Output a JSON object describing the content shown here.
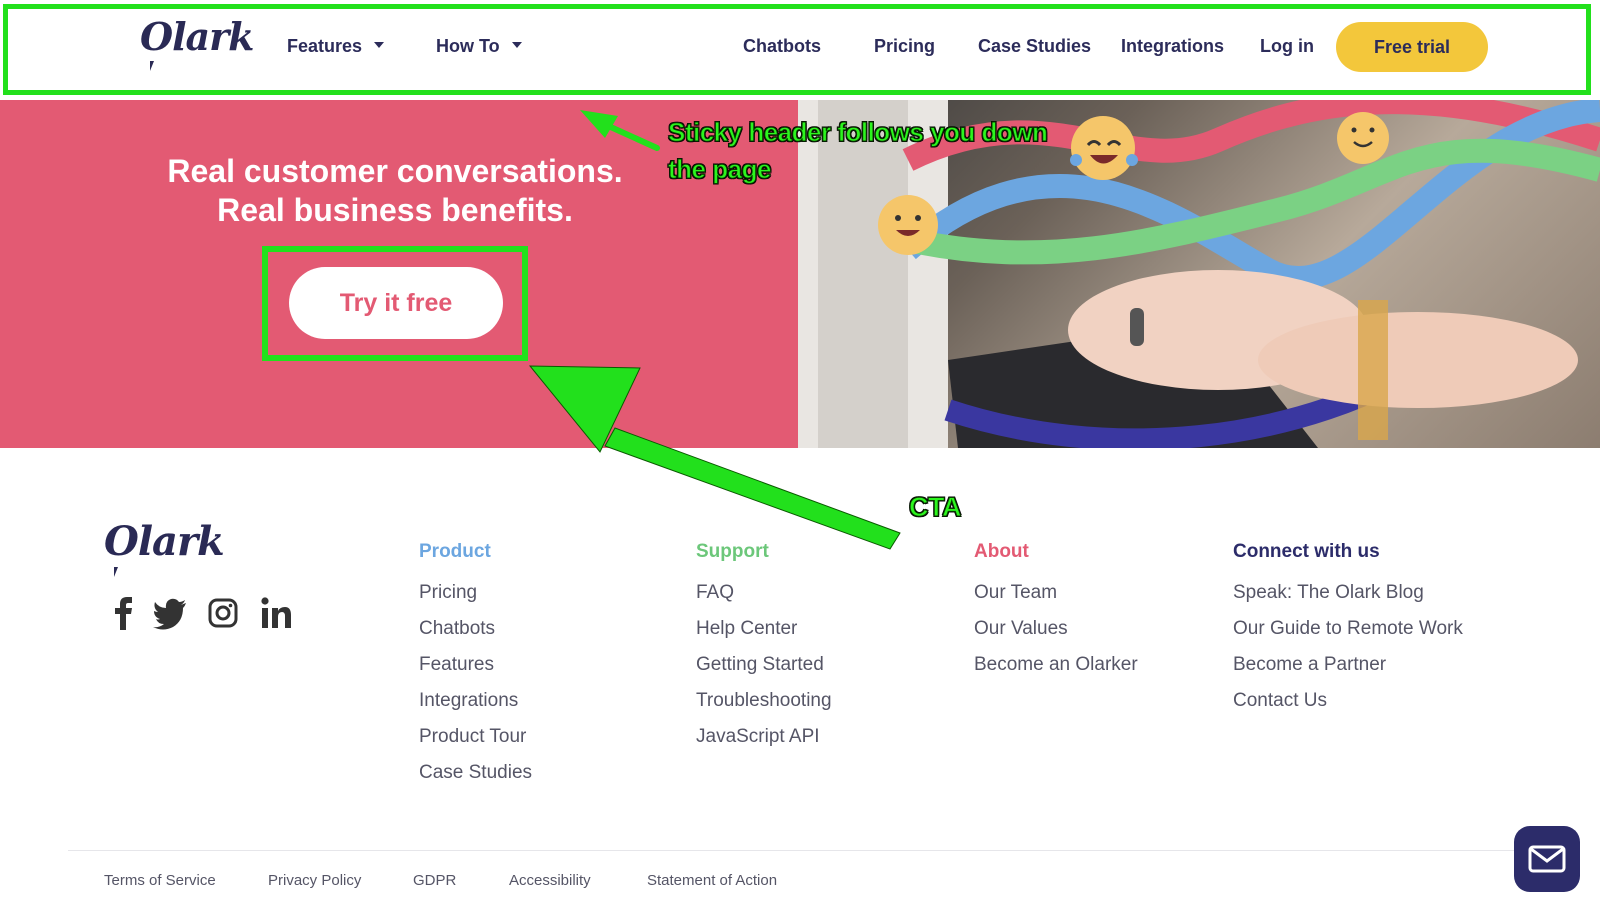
{
  "header": {
    "logo_text": "Olark",
    "nav_left": [
      {
        "label": "Features"
      },
      {
        "label": "How To"
      }
    ],
    "nav_right": [
      {
        "label": "Chatbots"
      },
      {
        "label": "Pricing"
      },
      {
        "label": "Case Studies"
      },
      {
        "label": "Integrations"
      },
      {
        "label": "Log in"
      }
    ],
    "cta_label": "Free trial"
  },
  "hero": {
    "headline_line1": "Real customer conversations.",
    "headline_line2": "Real business benefits.",
    "cta_label": "Try it free"
  },
  "annotations": {
    "sticky_line1": "Sticky header follows you down",
    "sticky_line2": "the page",
    "cta": "CTA"
  },
  "footer": {
    "logo_text": "Olark",
    "social": [
      "facebook-icon",
      "twitter-icon",
      "instagram-icon",
      "linkedin-icon"
    ],
    "columns": [
      {
        "title": "Product",
        "color": "#6ca6e0",
        "links": [
          "Pricing",
          "Chatbots",
          "Features",
          "Integrations",
          "Product Tour",
          "Case Studies"
        ]
      },
      {
        "title": "Support",
        "color": "#6cc77a",
        "links": [
          "FAQ",
          "Help Center",
          "Getting Started",
          "Troubleshooting",
          "JavaScript API"
        ]
      },
      {
        "title": "About",
        "color": "#e35a73",
        "links": [
          "Our Team",
          "Our Values",
          "Become an Olarker"
        ]
      },
      {
        "title": "Connect with us",
        "color": "#2c2c6a",
        "links": [
          "Speak: The Olark Blog",
          "Our Guide to Remote Work",
          "Become a Partner",
          "Contact Us"
        ]
      }
    ],
    "legal": [
      "Terms of Service",
      "Privacy Policy",
      "GDPR",
      "Accessibility",
      "Statement of Action"
    ]
  },
  "colors": {
    "hero_pink": "#e35a73",
    "cta_yellow": "#f3c73b",
    "annotation_green": "#22e01c",
    "brand_navy": "#2c2c6a"
  },
  "chat_launcher_icon": "envelope-icon"
}
